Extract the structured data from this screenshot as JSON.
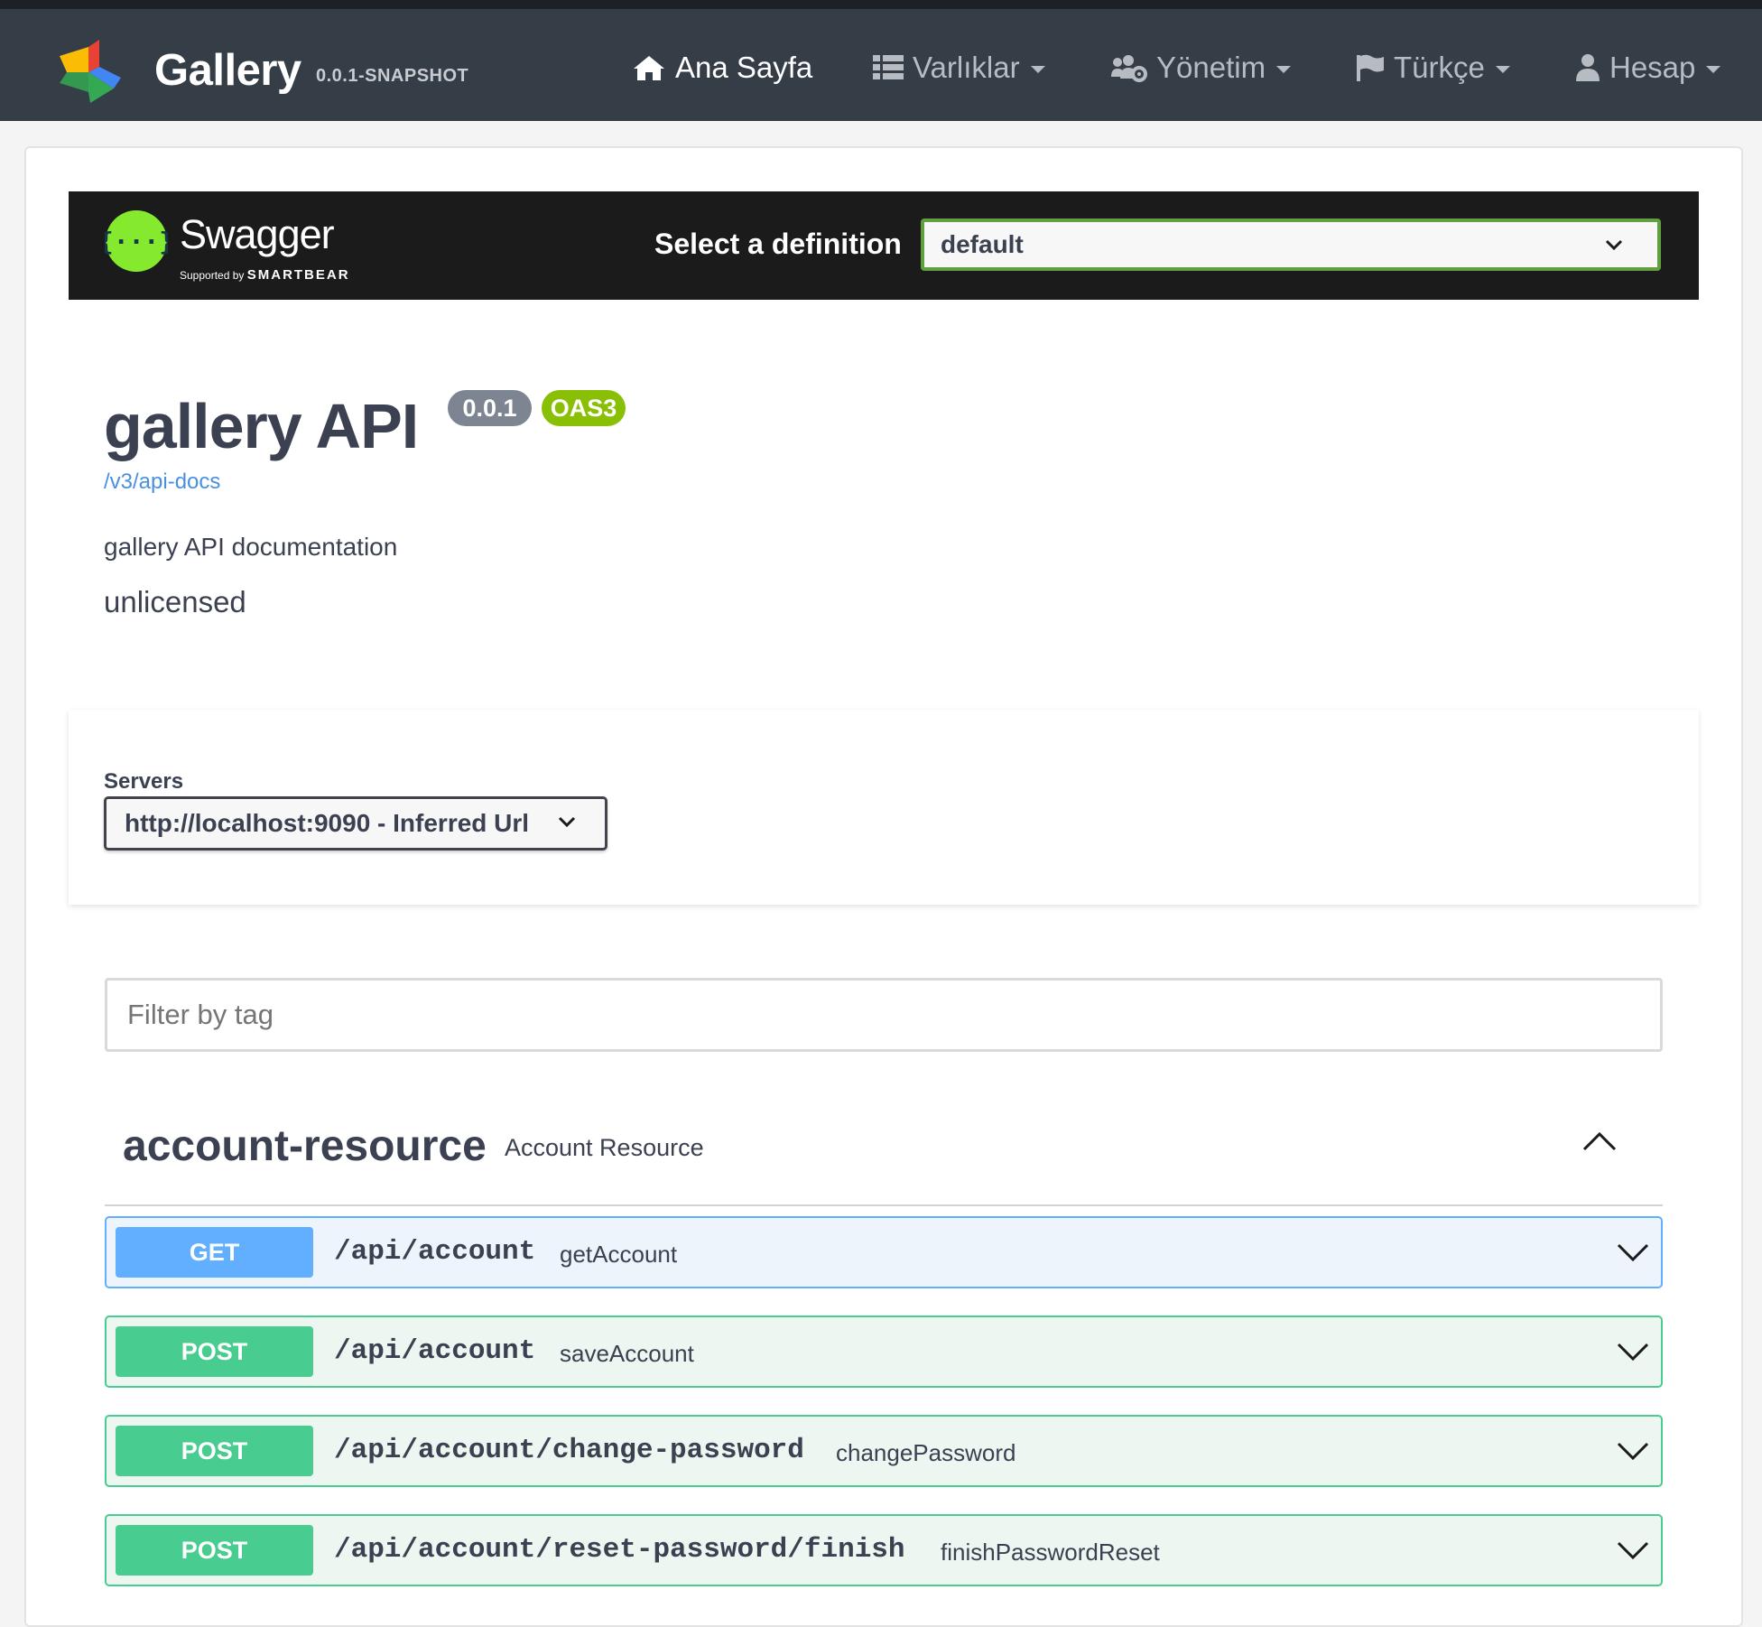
{
  "navbar": {
    "brand": "Gallery",
    "version": "0.0.1-SNAPSHOT",
    "items": [
      {
        "label": "Ana Sayfa",
        "icon": "home-icon"
      },
      {
        "label": "Varlıklar",
        "icon": "list-icon"
      },
      {
        "label": "Yönetim",
        "icon": "users-cog-icon"
      },
      {
        "label": "Türkçe",
        "icon": "flag-icon"
      },
      {
        "label": "Hesap",
        "icon": "user-icon"
      }
    ]
  },
  "swagger": {
    "name": "Swagger",
    "supported_by": "Supported by",
    "smartbear": "SMARTBEAR",
    "definition_label": "Select a definition",
    "definition_value": "default"
  },
  "info": {
    "title": "gallery API",
    "version": "0.0.1",
    "oas": "OAS3",
    "url": "/v3/api-docs",
    "description": "gallery API documentation",
    "license": "unlicensed"
  },
  "servers": {
    "label": "Servers",
    "selected": "http://localhost:9090 - Inferred Url"
  },
  "filter": {
    "placeholder": "Filter by tag"
  },
  "tag": {
    "name": "account-resource",
    "description": "Account Resource"
  },
  "operations": [
    {
      "method": "GET",
      "path": "/api/account",
      "operation_id": "getAccount"
    },
    {
      "method": "POST",
      "path": "/api/account",
      "operation_id": "saveAccount"
    },
    {
      "method": "POST",
      "path": "/api/account/change-password",
      "operation_id": "changePassword"
    },
    {
      "method": "POST",
      "path": "/api/account/reset-password/finish",
      "operation_id": "finishPasswordReset"
    }
  ],
  "colors": {
    "navbar": "#353d47",
    "swagger_bar": "#1b1b1b",
    "get": "#61affe",
    "post": "#49cc90",
    "oas_badge": "#89bf04",
    "link": "#4990e2"
  }
}
